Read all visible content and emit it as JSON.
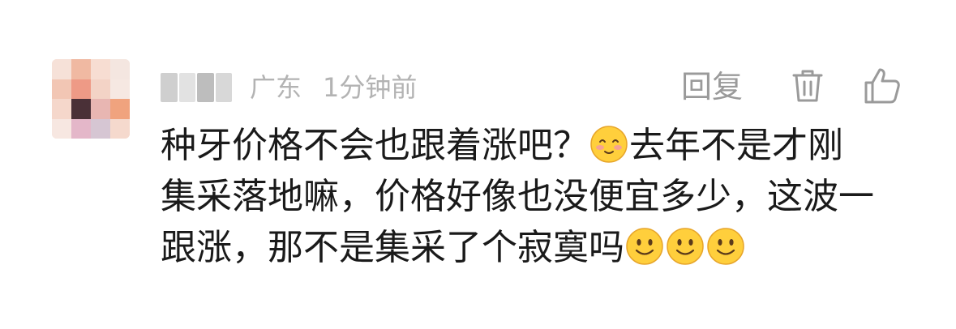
{
  "comment": {
    "location": "广东",
    "time": "1分钟前",
    "reply_label": "回复",
    "text_lines": [
      {
        "before": "种牙价格不会也跟着涨吧？",
        "after": "去年不是才刚"
      },
      {
        "text": "集采落地嘛，价格好像也没便宜多少，这波一"
      },
      {
        "text": "跟涨，那不是集采了个寂寞吗"
      }
    ],
    "emojis": {
      "blush": "smiling-face-with-blush-icon",
      "smile": "slightly-smiling-face-icon"
    }
  },
  "colors": {
    "meta_text": "#b3b3b3",
    "action_text": "#9a9a9a",
    "body_text": "#1a1a1a",
    "emoji_yellow": "#ffcf3c"
  }
}
